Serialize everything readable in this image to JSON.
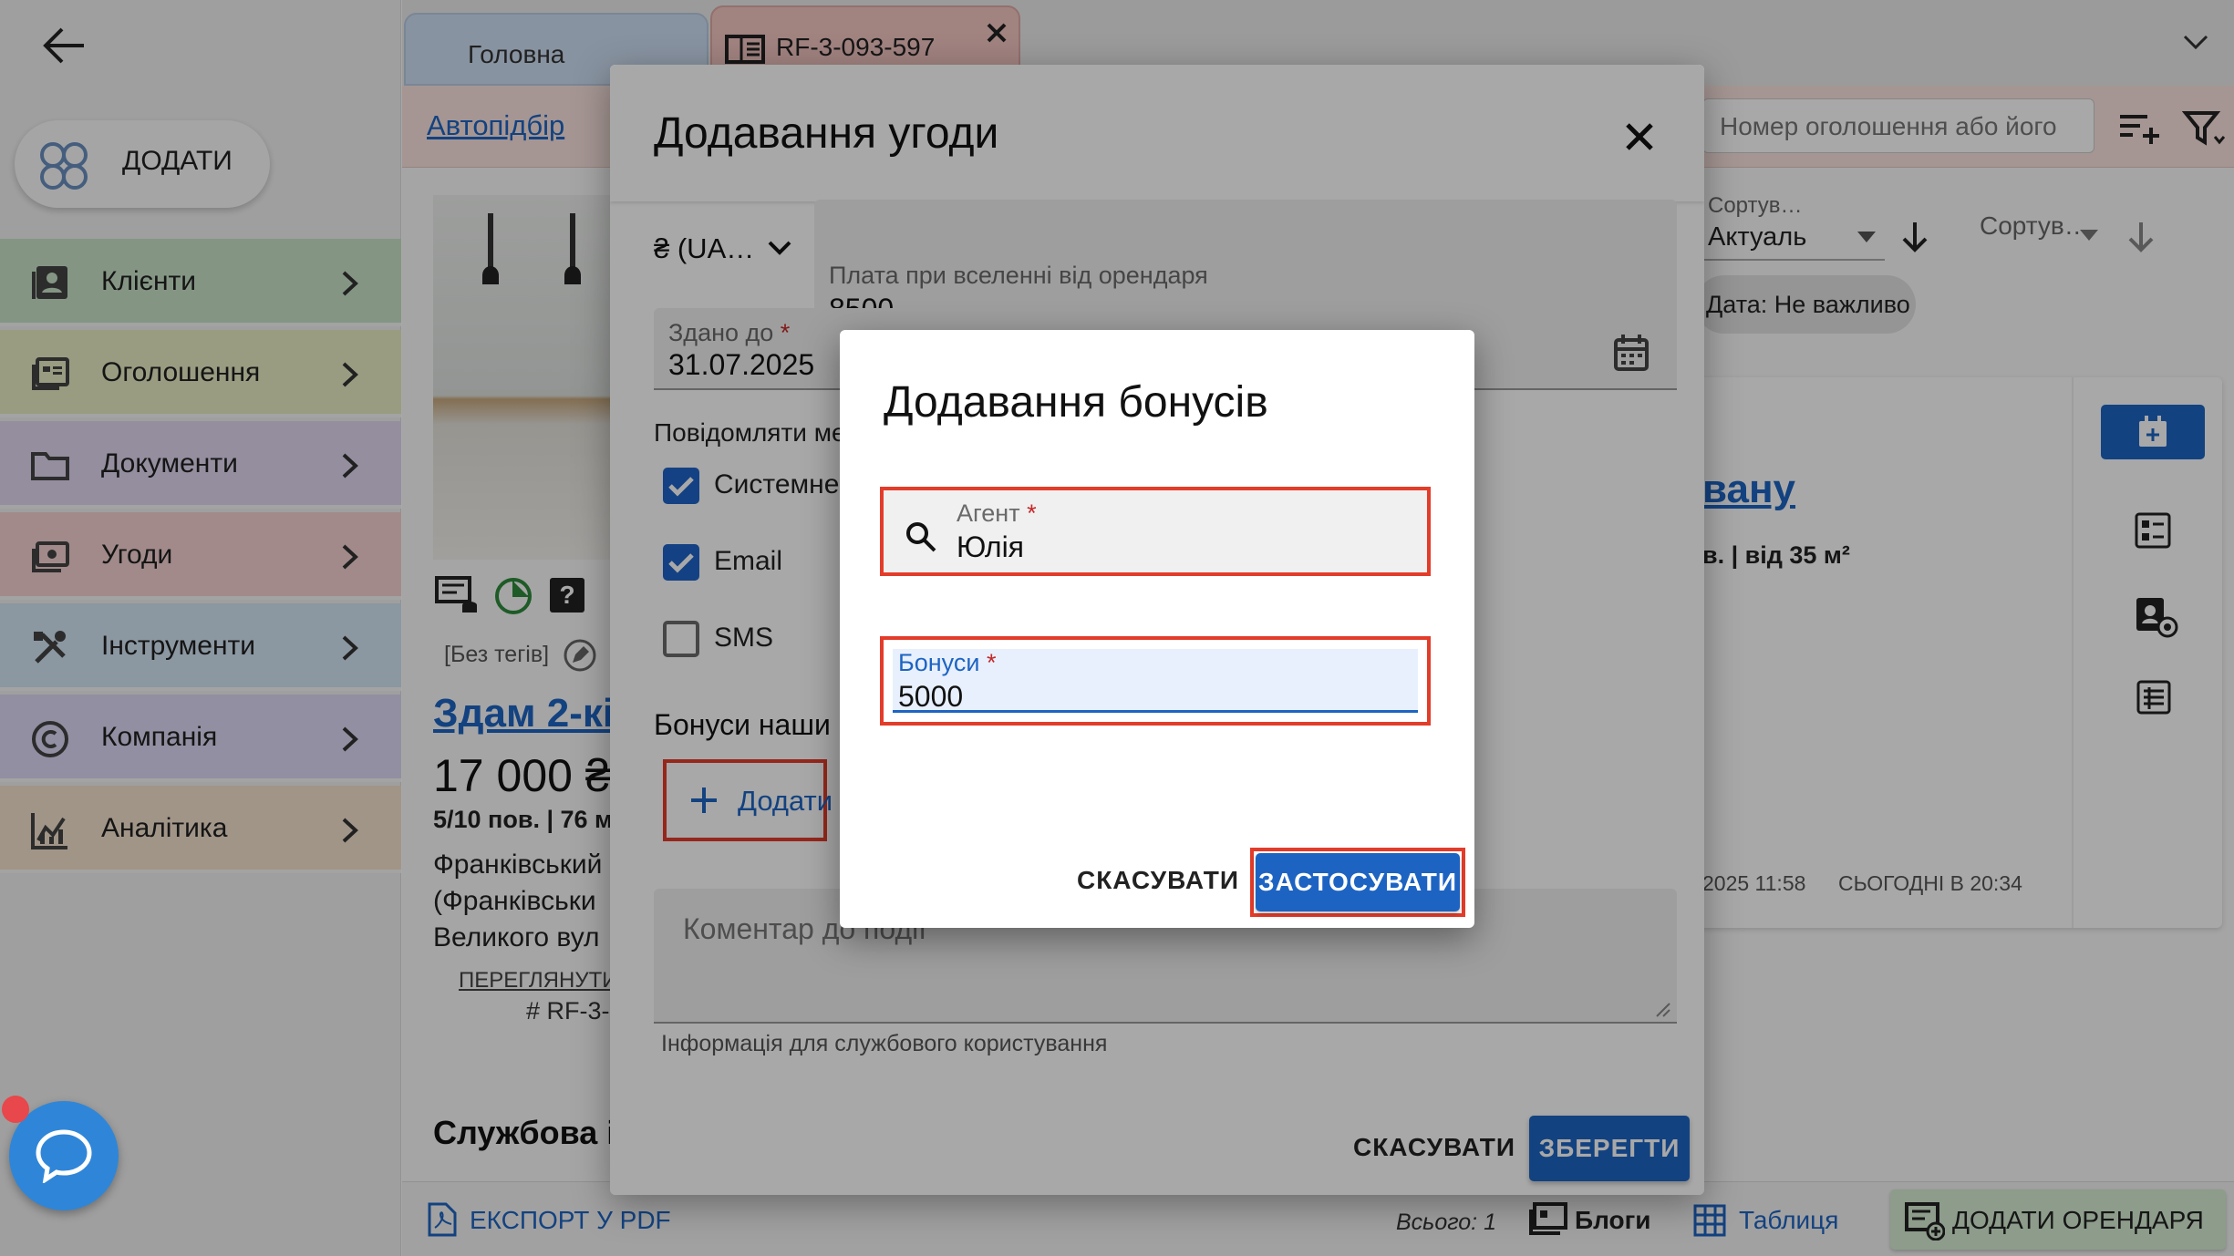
{
  "sidebar": {
    "back_icon": "arrow-left-icon",
    "add_button": "ДОДАТИ",
    "items": [
      {
        "label": "Клієнти",
        "color": "#c9e3c8",
        "icon": "contacts-icon"
      },
      {
        "label": "Оголошення",
        "color": "#e9edc4",
        "icon": "listings-icon"
      },
      {
        "label": "Документи",
        "color": "#e2d8f2",
        "icon": "folder-icon"
      },
      {
        "label": "Угоди",
        "color": "#f6d2d2",
        "icon": "deals-icon"
      },
      {
        "label": "Інструменти",
        "color": "#d4e5f5",
        "icon": "tools-icon"
      },
      {
        "label": "Компанія",
        "color": "#dcd9f5",
        "icon": "copyright-icon"
      },
      {
        "label": "Аналітика",
        "color": "#f5e2cf",
        "icon": "analytics-icon"
      }
    ]
  },
  "tabs": {
    "home": "Головна",
    "listing": "RF-3-093-597"
  },
  "toolbar": {
    "autoselect_link": "Автопідбір",
    "search_placeholder": "Номер оголошення або його",
    "sort1_label": "Сортув…",
    "sort1_value": "Актуаль",
    "sort2_label": "Сортув…",
    "date_chip": "Дата: Не важливо"
  },
  "listing": {
    "tags": "[Без тегів]",
    "title": "Здам 2-кім",
    "price": "17 000 ₴",
    "floor": "5/10 пов. | 76 м",
    "address_l1": "Франківський",
    "address_l2": "(Франківськи",
    "address_l3": "Великого вул",
    "view_link": "ПЕРЕГЛЯНУТИ Н",
    "id": "# RF-3-0",
    "service_heading": "Службова ін"
  },
  "right_card": {
    "title_link": "вану",
    "subtitle": "в. | від 35 м²",
    "date1": "2025 11:58",
    "date2": "СЬОГОДНІ В 20:34"
  },
  "footer": {
    "export": "ЕКСПОРТ У PDF",
    "total": "Всього: 1",
    "blogs": "Блоги",
    "table": "Таблиця",
    "add_tenant": "ДОДАТИ ОРЕНДАРЯ"
  },
  "deal_dialog": {
    "title": "Додавання угоди",
    "currency": "₴ (UA…",
    "payment_label": "Плата при вселенні від орендаря",
    "payment_value": "8500",
    "rented_until_label": "Здано до",
    "rented_until_value": "31.07.2025",
    "notify_label": "Повідомляти ме",
    "checkbox_system": "Системне",
    "checkbox_email": "Email",
    "checkbox_sms": "SMS",
    "bonuses_heading": "Бонуси наши",
    "add_bonus_button": "Додати",
    "comment_placeholder": "Коментар до події",
    "comment_hint": "Інформація для службового користування",
    "cancel_button": "СКАСУВАТИ",
    "save_button": "ЗБЕРЕГТИ"
  },
  "bonus_dialog": {
    "title": "Додавання бонусів",
    "agent_label": "Агент",
    "agent_value": "Юлія",
    "bonus_label": "Бонуси",
    "bonus_value": "5000",
    "cancel_button": "СКАСУВАТИ",
    "apply_button": "ЗАСТОСУВАТИ"
  },
  "colors": {
    "primary": "#1d64c2",
    "highlight": "#e33c2a",
    "chat": "#2f86d8"
  }
}
